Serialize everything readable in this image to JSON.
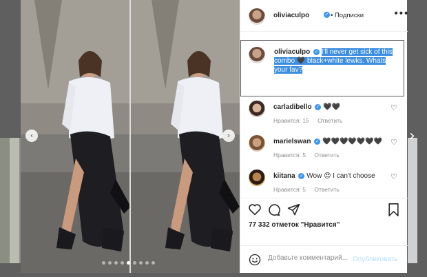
{
  "post": {
    "username": "oliviaculpo",
    "follow_separator": "•",
    "follow_status": "Подписки",
    "verified_mark": "✓",
    "caption_username": "oliviaculpo",
    "caption_text": "I'll never get sick of this combo 🖤 black+white lewks. Whats your fav?",
    "more_icon": "more-options-icon"
  },
  "comments": [
    {
      "username": "carladibello",
      "text": "🖤🖤",
      "likes": "Нравится: 15",
      "reply": "Ответить"
    },
    {
      "username": "marielswan",
      "text": "🖤🖤🖤🖤🖤🖤🖤",
      "likes": "Нравится: 5",
      "reply": "Ответить"
    },
    {
      "username": "kiitana",
      "text": "Wow 😍 I can't choose",
      "likes": "Нравится: 5",
      "reply": "Ответить"
    }
  ],
  "actions": {
    "icons": [
      "heart-icon",
      "comment-icon",
      "share-icon",
      "bookmark-icon"
    ],
    "likes_text": "77 332 отметок \"Нравится\""
  },
  "composer": {
    "placeholder": "Добавьте комментарий...",
    "post_label": "Опубликовать",
    "emoji_icon": "emoji-icon"
  },
  "carousel": {
    "prev_symbol": "‹",
    "next_symbol": "›",
    "dots_total": 9,
    "active_dot": 4
  },
  "page_nav": {
    "next_symbol": "›"
  },
  "colors": {
    "accent": "#3897f0",
    "selection": "#3b8de0",
    "post_disabled": "#b2dffc",
    "muted": "#8e8e8e",
    "text": "#262626"
  }
}
